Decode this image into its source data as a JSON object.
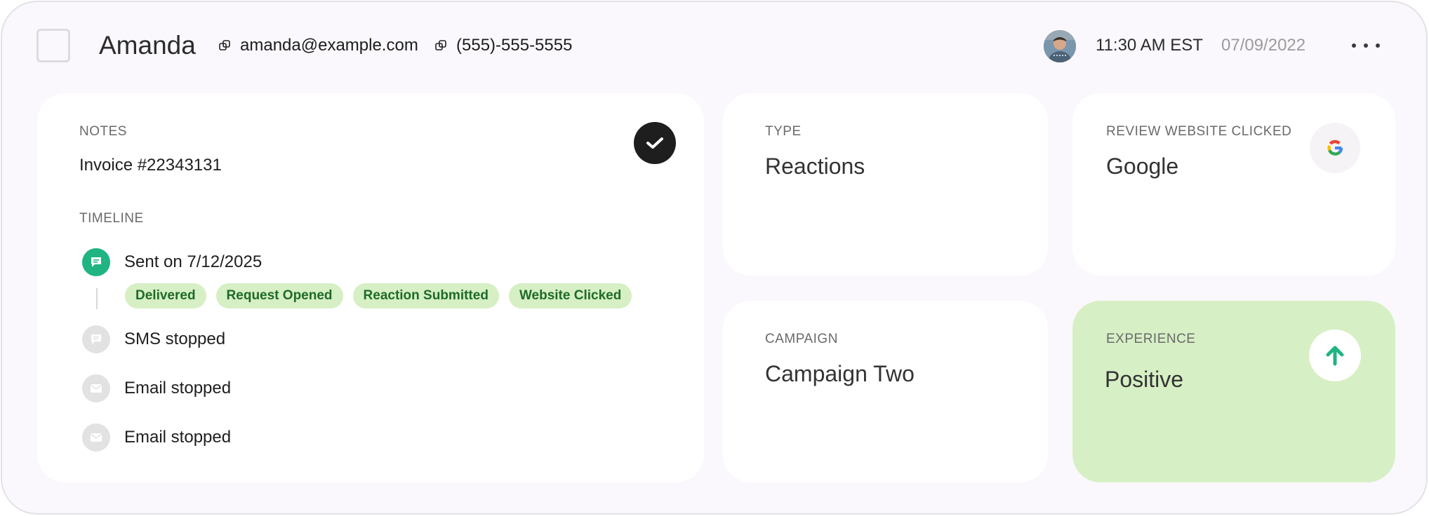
{
  "header": {
    "name": "Amanda",
    "email": "amanda@example.com",
    "phone": "(555)-555-5555",
    "time": "11:30 AM EST",
    "date": "07/09/2022"
  },
  "notes": {
    "label": "NOTES",
    "text": "Invoice #22343131",
    "timeline_label": "TIMELINE",
    "timeline": [
      {
        "text": "Sent on 7/12/2025",
        "icon": "sms-icon",
        "status": "active"
      },
      {
        "text": "SMS stopped",
        "icon": "sms-icon",
        "status": "inactive"
      },
      {
        "text": "Email stopped",
        "icon": "mail-icon",
        "status": "inactive"
      },
      {
        "text": "Email stopped",
        "icon": "mail-icon",
        "status": "inactive"
      }
    ],
    "tags": [
      "Delivered",
      "Request Opened",
      "Reaction Submitted",
      "Website Clicked"
    ]
  },
  "type_card": {
    "label": "TYPE",
    "value": "Reactions"
  },
  "review_card": {
    "label": "REVIEW WEBSITE CLICKED",
    "value": "Google",
    "icon": "google-icon"
  },
  "campaign_card": {
    "label": "CAMPAIGN",
    "value": "Campaign Two"
  },
  "experience_card": {
    "label": "EXPERIENCE",
    "value": "Positive",
    "icon": "arrow-up-icon"
  },
  "colors": {
    "accent_green": "#1fb482",
    "tag_bg": "#d6efc4",
    "tag_text": "#1f6a2a",
    "dark": "#1e1e1e"
  }
}
